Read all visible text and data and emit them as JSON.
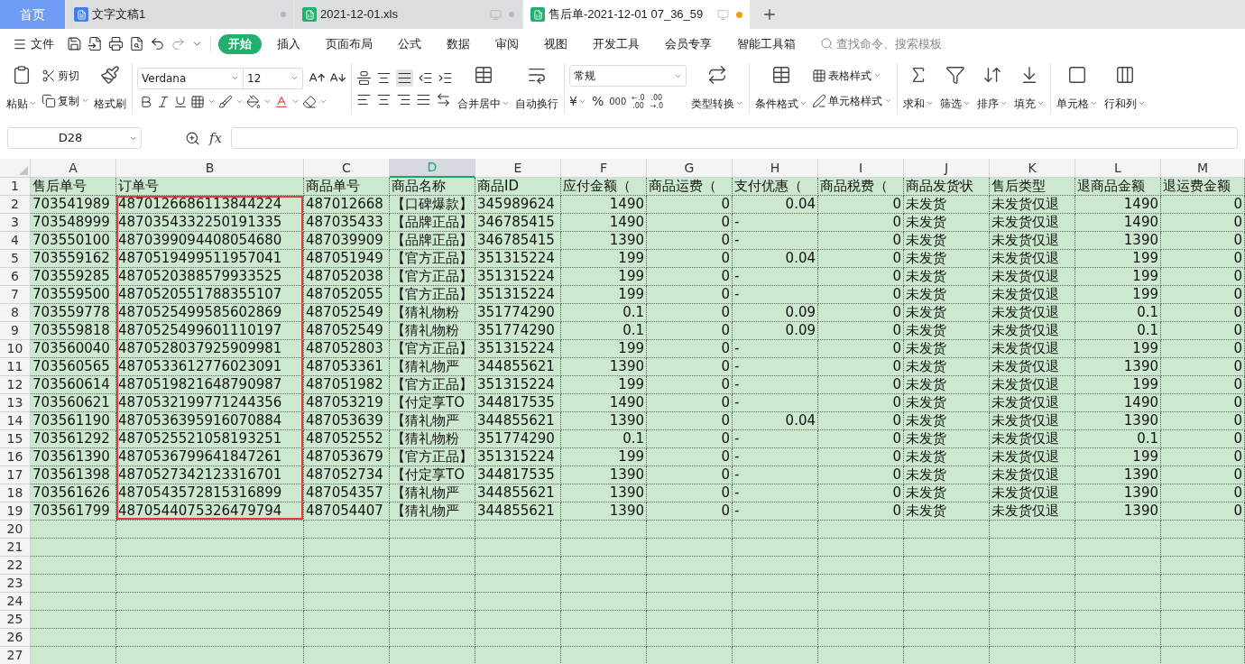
{
  "app_tabs": [
    {
      "label": "首页",
      "kind": "home",
      "selected": false
    },
    {
      "label": "文字文稿1",
      "kind": "writer",
      "selected": false,
      "unsaved": false
    },
    {
      "label": "2021-12-01.xls",
      "kind": "sheet",
      "selected": false,
      "unsaved": false
    },
    {
      "label": "售后单-2021-12-01 07_36_59",
      "kind": "sheet",
      "selected": true,
      "unsaved": true
    }
  ],
  "menu": {
    "file": "文件",
    "tabs": [
      {
        "label": "开始",
        "selected": true
      },
      {
        "label": "插入",
        "selected": false
      },
      {
        "label": "页面布局",
        "selected": false
      },
      {
        "label": "公式",
        "selected": false
      },
      {
        "label": "数据",
        "selected": false
      },
      {
        "label": "审阅",
        "selected": false
      },
      {
        "label": "视图",
        "selected": false
      },
      {
        "label": "开发工具",
        "selected": false
      },
      {
        "label": "会员专享",
        "selected": false
      },
      {
        "label": "智能工具箱",
        "selected": false
      }
    ],
    "search": {
      "placeholder": "查找命令、搜索模板"
    }
  },
  "ribbon": {
    "paste": "粘贴",
    "cut": "剪切",
    "copy": "复制",
    "format_painter": "格式刷",
    "font": "Verdana",
    "size": "12",
    "merge": "合并居中",
    "wrap": "自动换行",
    "number_format": "常规",
    "currency": "¥",
    "percent": "%",
    "thousands": "000",
    "inc_decimal": [
      "←.0",
      ".00"
    ],
    "dec_decimal": [
      ".00",
      "→.0"
    ],
    "convert": "类型转换",
    "cond_format": "条件格式",
    "table_style": "表格样式",
    "cell_style": "单元格样式",
    "sum": "求和",
    "filter": "筛选",
    "sort": "排序",
    "fill": "填充",
    "cell": "单元格",
    "row_col": "行和列"
  },
  "formula_bar": {
    "name_box": "D28",
    "fx": "fx"
  },
  "sheet": {
    "columns": [
      {
        "label": "A",
        "selected": false,
        "right_aligned": false,
        "outlined": false
      },
      {
        "label": "B",
        "selected": false,
        "right_aligned": false,
        "outlined": true
      },
      {
        "label": "C",
        "selected": false,
        "right_aligned": false,
        "outlined": false
      },
      {
        "label": "D",
        "selected": true,
        "right_aligned": false,
        "outlined": false
      },
      {
        "label": "E",
        "selected": false,
        "right_aligned": false,
        "outlined": false
      },
      {
        "label": "F",
        "selected": false,
        "right_aligned": true,
        "outlined": false
      },
      {
        "label": "G",
        "selected": false,
        "right_aligned": true,
        "outlined": false
      },
      {
        "label": "H",
        "selected": false,
        "right_aligned": true,
        "outlined": false
      },
      {
        "label": "I",
        "selected": false,
        "right_aligned": true,
        "outlined": false
      },
      {
        "label": "J",
        "selected": false,
        "right_aligned": false,
        "outlined": false
      },
      {
        "label": "K",
        "selected": false,
        "right_aligned": false,
        "outlined": false
      },
      {
        "label": "L",
        "selected": false,
        "right_aligned": true,
        "outlined": false
      },
      {
        "label": "M",
        "selected": false,
        "right_aligned": true,
        "outlined": false
      }
    ],
    "rows": [
      {
        "num": "1",
        "kind": "header",
        "outlined": false,
        "cells": [
          "售后单号",
          "订单号",
          "商品单号",
          "商品名称",
          "商品ID",
          "应付金额（",
          "商品运费（",
          "支付优惠（",
          "商品税费（",
          "商品发货状",
          "售后类型",
          "退商品金额",
          "退运费金额"
        ]
      },
      {
        "num": "2",
        "kind": "data",
        "outlined": true,
        "cells": [
          "703541989",
          "4870126686113844224",
          "487012668",
          "【口碑爆款】",
          "345989624",
          "1490",
          "0",
          "0.04",
          "0",
          "未发货",
          "未发货仅退",
          "1490",
          "0"
        ]
      },
      {
        "num": "3",
        "kind": "data",
        "outlined": true,
        "cells": [
          "703548999",
          "4870354332250191335",
          "487035433",
          "【品牌正品】",
          "346785415",
          "1490",
          "0",
          {
            "text": "-",
            "left_aligned": true
          },
          "0",
          "未发货",
          "未发货仅退",
          "1490",
          "0"
        ]
      },
      {
        "num": "4",
        "kind": "data",
        "outlined": true,
        "cells": [
          "703550100",
          "4870399094408054680",
          "487039909",
          "【品牌正品】",
          "346785415",
          "1390",
          "0",
          {
            "text": "-",
            "left_aligned": true
          },
          "0",
          "未发货",
          "未发货仅退",
          "1390",
          "0"
        ]
      },
      {
        "num": "5",
        "kind": "data",
        "outlined": true,
        "cells": [
          "703559162",
          "4870519499511957041",
          "487051949",
          "【官方正品】",
          "351315224",
          "199",
          "0",
          "0.04",
          "0",
          "未发货",
          "未发货仅退",
          "199",
          "0"
        ]
      },
      {
        "num": "6",
        "kind": "data",
        "outlined": true,
        "cells": [
          "703559285",
          "4870520388579933525",
          "487052038",
          "【官方正品】",
          "351315224",
          "199",
          "0",
          {
            "text": "-",
            "left_aligned": true
          },
          "0",
          "未发货",
          "未发货仅退",
          "199",
          "0"
        ]
      },
      {
        "num": "7",
        "kind": "data",
        "outlined": true,
        "cells": [
          "703559500",
          "4870520551788355107",
          "487052055",
          "【官方正品】",
          "351315224",
          "199",
          "0",
          {
            "text": "-",
            "left_aligned": true
          },
          "0",
          "未发货",
          "未发货仅退",
          "199",
          "0"
        ]
      },
      {
        "num": "8",
        "kind": "data",
        "outlined": true,
        "cells": [
          "703559778",
          "4870525499585602869",
          "487052549",
          "【猜礼物粉",
          "351774290",
          "0.1",
          "0",
          "0.09",
          "0",
          "未发货",
          "未发货仅退",
          "0.1",
          "0"
        ]
      },
      {
        "num": "9",
        "kind": "data",
        "outlined": true,
        "cells": [
          "703559818",
          "4870525499601110197",
          "487052549",
          "【猜礼物粉",
          "351774290",
          "0.1",
          "0",
          "0.09",
          "0",
          "未发货",
          "未发货仅退",
          "0.1",
          "0"
        ]
      },
      {
        "num": "10",
        "kind": "data",
        "outlined": true,
        "cells": [
          "703560040",
          "4870528037925909981",
          "487052803",
          "【官方正品】",
          "351315224",
          "199",
          "0",
          {
            "text": "-",
            "left_aligned": true
          },
          "0",
          "未发货",
          "未发货仅退",
          "199",
          "0"
        ]
      },
      {
        "num": "11",
        "kind": "data",
        "outlined": true,
        "cells": [
          "703560565",
          "4870533612776023091",
          "487053361",
          "【猜礼物严",
          "344855621",
          "1390",
          "0",
          {
            "text": "-",
            "left_aligned": true
          },
          "0",
          "未发货",
          "未发货仅退",
          "1390",
          "0"
        ]
      },
      {
        "num": "12",
        "kind": "data",
        "outlined": true,
        "cells": [
          "703560614",
          "4870519821648790987",
          "487051982",
          "【官方正品】",
          "351315224",
          "199",
          "0",
          {
            "text": "-",
            "left_aligned": true
          },
          "0",
          "未发货",
          "未发货仅退",
          "199",
          "0"
        ]
      },
      {
        "num": "13",
        "kind": "data",
        "outlined": true,
        "cells": [
          "703560621",
          "4870532199771244356",
          "487053219",
          "【付定享TO",
          "344817535",
          "1490",
          "0",
          {
            "text": "-",
            "left_aligned": true
          },
          "0",
          "未发货",
          "未发货仅退",
          "1490",
          "0"
        ]
      },
      {
        "num": "14",
        "kind": "data",
        "outlined": true,
        "cells": [
          "703561190",
          "4870536395916070884",
          "487053639",
          "【猜礼物严",
          "344855621",
          "1390",
          "0",
          "0.04",
          "0",
          "未发货",
          "未发货仅退",
          "1390",
          "0"
        ]
      },
      {
        "num": "15",
        "kind": "data",
        "outlined": true,
        "cells": [
          "703561292",
          "4870525521058193251",
          "487052552",
          "【猜礼物粉",
          "351774290",
          "0.1",
          "0",
          {
            "text": "-",
            "left_aligned": true
          },
          "0",
          "未发货",
          "未发货仅退",
          "0.1",
          "0"
        ]
      },
      {
        "num": "16",
        "kind": "data",
        "outlined": true,
        "cells": [
          "703561390",
          "4870536799641847261",
          "487053679",
          "【官方正品】",
          "351315224",
          "199",
          "0",
          {
            "text": "-",
            "left_aligned": true
          },
          "0",
          "未发货",
          "未发货仅退",
          "199",
          "0"
        ]
      },
      {
        "num": "17",
        "kind": "data",
        "outlined": true,
        "cells": [
          "703561398",
          "4870527342123316701",
          "487052734",
          "【付定享TO",
          "344817535",
          "1390",
          "0",
          {
            "text": "-",
            "left_aligned": true
          },
          "0",
          "未发货",
          "未发货仅退",
          "1390",
          "0"
        ]
      },
      {
        "num": "18",
        "kind": "data",
        "outlined": true,
        "cells": [
          "703561626",
          "4870543572815316899",
          "487054357",
          "【猜礼物严",
          "344855621",
          "1390",
          "0",
          {
            "text": "-",
            "left_aligned": true
          },
          "0",
          "未发货",
          "未发货仅退",
          "1390",
          "0"
        ]
      },
      {
        "num": "19",
        "kind": "data",
        "outlined": true,
        "cells": [
          "703561799",
          "4870544075326479794",
          "487054407",
          "【猜礼物严",
          "344855621",
          "1390",
          "0",
          {
            "text": "-",
            "left_aligned": true
          },
          "0",
          "未发货",
          "未发货仅退",
          "1390",
          "0"
        ]
      },
      {
        "num": "20",
        "kind": "blank",
        "outlined": false
      },
      {
        "num": "21",
        "kind": "blank",
        "outlined": false
      },
      {
        "num": "22",
        "kind": "blank",
        "outlined": false
      },
      {
        "num": "23",
        "kind": "blank",
        "outlined": false
      },
      {
        "num": "24",
        "kind": "blank",
        "outlined": false
      },
      {
        "num": "25",
        "kind": "blank",
        "outlined": false
      },
      {
        "num": "26",
        "kind": "blank",
        "outlined": false
      },
      {
        "num": "27",
        "kind": "blank",
        "outlined": false
      }
    ]
  }
}
